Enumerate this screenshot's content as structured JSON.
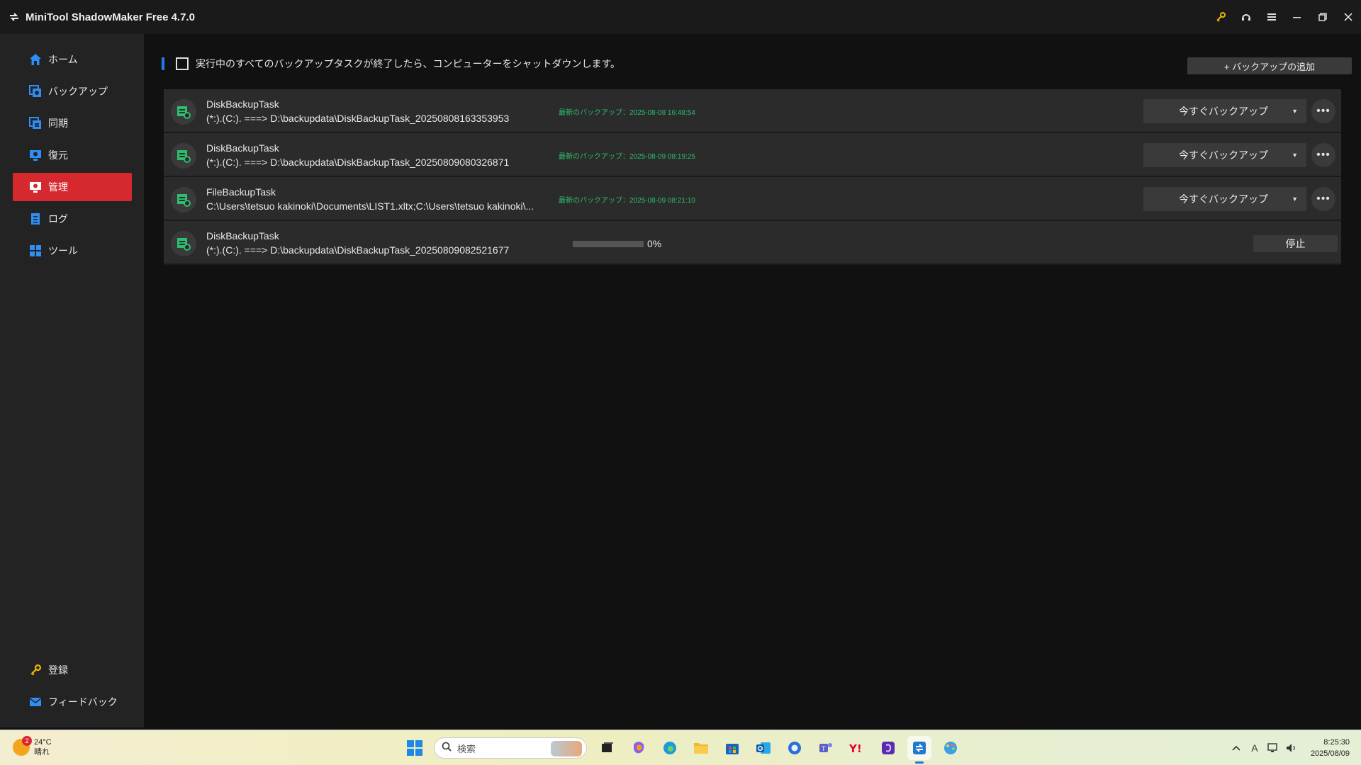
{
  "window": {
    "title": "MiniTool ShadowMaker Free 4.7.0",
    "controls": [
      "key-icon",
      "headset-icon",
      "menu-icon",
      "minimize-icon",
      "restore-icon",
      "close-icon"
    ]
  },
  "sidebar": {
    "items": [
      {
        "label": "ホーム",
        "icon": "home-icon"
      },
      {
        "label": "バックアップ",
        "icon": "backup-icon"
      },
      {
        "label": "同期",
        "icon": "sync-icon"
      },
      {
        "label": "復元",
        "icon": "restore-icon"
      },
      {
        "label": "管理",
        "icon": "manage-icon",
        "active": true
      },
      {
        "label": "ログ",
        "icon": "log-icon"
      },
      {
        "label": "ツール",
        "icon": "tools-icon"
      }
    ],
    "bottom": [
      {
        "label": "登録",
        "icon": "key-icon"
      },
      {
        "label": "フィードバック",
        "icon": "mail-icon"
      }
    ]
  },
  "main": {
    "shutdown_label": "実行中のすべてのバックアップタスクが終了したら、コンピューターをシャットダウンします。",
    "add_backup_label": "+ バックアップの追加",
    "backup_now_label": "今すぐバックアップ",
    "stop_label": "停止",
    "tasks": [
      {
        "name": "DiskBackupTask",
        "path": "(*:).(C:). ===> D:\\backupdata\\DiskBackupTask_20250808163353953",
        "last_backup": "最新のバックアップ：2025-08-08 16:48:54"
      },
      {
        "name": "DiskBackupTask",
        "path": "(*:).(C:). ===> D:\\backupdata\\DiskBackupTask_20250809080326871",
        "last_backup": "最新のバックアップ：2025-08-09 08:19:25"
      },
      {
        "name": "FileBackupTask",
        "path": "C:\\Users\\tetsuo kakinoki\\Documents\\LIST1.xltx;C:\\Users\\tetsuo kakinoki\\...",
        "last_backup": "最新のバックアップ：2025-08-09 08:21:10"
      },
      {
        "name": "DiskBackupTask",
        "path": "(*:).(C:). ===> D:\\backupdata\\DiskBackupTask_20250809082521677",
        "progress": 0,
        "progress_text": "0%"
      }
    ]
  },
  "taskbar": {
    "weather_temp": "24°C",
    "weather_desc": "晴れ",
    "weather_badge": "2",
    "search_placeholder": "検索",
    "time": "8:25:30",
    "date": "2025/08/09",
    "ime_label": "A"
  }
}
